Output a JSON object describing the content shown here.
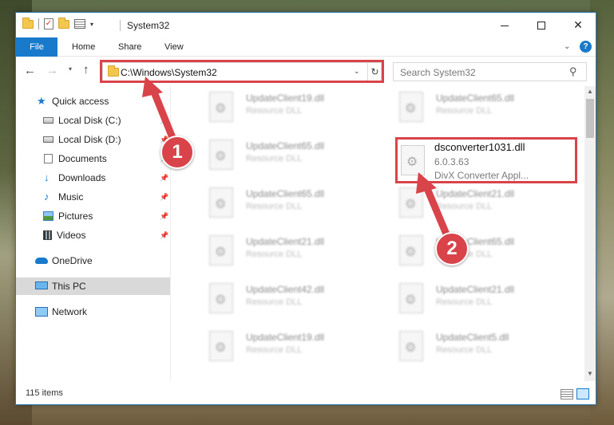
{
  "window": {
    "title": "System32",
    "qat_dropdown": "▾",
    "controls": {
      "minimize": "",
      "maximize": "",
      "close": "✕"
    }
  },
  "ribbon": {
    "tabs": [
      "File",
      "Home",
      "Share",
      "View"
    ],
    "expand_icon": "chevron-down-icon",
    "help_icon": "?"
  },
  "address": {
    "path": "C:\\Windows\\System32",
    "refresh_icon": "↻",
    "dropdown_icon": "⌄"
  },
  "search": {
    "placeholder": "Search System32"
  },
  "sidebar": {
    "items": [
      {
        "label": "Quick access",
        "icon": "star-icon"
      },
      {
        "label": "Local Disk (C:)",
        "icon": "disk-icon",
        "pinned": true
      },
      {
        "label": "Local Disk (D:)",
        "icon": "disk-icon",
        "pinned": true
      },
      {
        "label": "Documents",
        "icon": "documents-icon",
        "pinned": true
      },
      {
        "label": "Downloads",
        "icon": "downloads-icon",
        "pinned": true
      },
      {
        "label": "Music",
        "icon": "music-icon",
        "pinned": true
      },
      {
        "label": "Pictures",
        "icon": "pictures-icon",
        "pinned": true
      },
      {
        "label": "Videos",
        "icon": "videos-icon",
        "pinned": true
      },
      {
        "label": "OneDrive",
        "icon": "onedrive-icon"
      },
      {
        "label": "This PC",
        "icon": "pc-icon",
        "selected": true
      },
      {
        "label": "Network",
        "icon": "network-icon"
      }
    ]
  },
  "files": {
    "left_column": [
      {
        "name": "UpdateClient19.dll",
        "type": "Resource DLL"
      },
      {
        "name": "UpdateClient65.dll",
        "type": "Resource DLL"
      },
      {
        "name": "UpdateClient65.dll",
        "type": "Resource DLL"
      },
      {
        "name": "UpdateClient21.dll",
        "type": "Resource DLL"
      },
      {
        "name": "UpdateClient42.dll",
        "type": "Resource DLL"
      },
      {
        "name": "UpdateClient19.dll",
        "type": "Resource DLL"
      }
    ],
    "right_column": [
      {
        "name": "UpdateClient65.dll",
        "type": "Resource DLL"
      },
      {
        "name": "UpdateClient21.dll",
        "type": "Resource DLL"
      },
      {
        "name": "UpdateClient65.dll",
        "type": "Resource DLL"
      },
      {
        "name": "UpdateClient21.dll",
        "type": "Resource DLL"
      },
      {
        "name": "UpdateClient5.dll",
        "type": "Resource DLL"
      }
    ],
    "focused": {
      "name": "dsconverter1031.dll",
      "version": "6.0.3.63",
      "type": "DivX Converter Appl..."
    }
  },
  "status": {
    "item_count": "115 items"
  },
  "annotations": {
    "step1": "1",
    "step2": "2",
    "color": "#d9434a"
  }
}
